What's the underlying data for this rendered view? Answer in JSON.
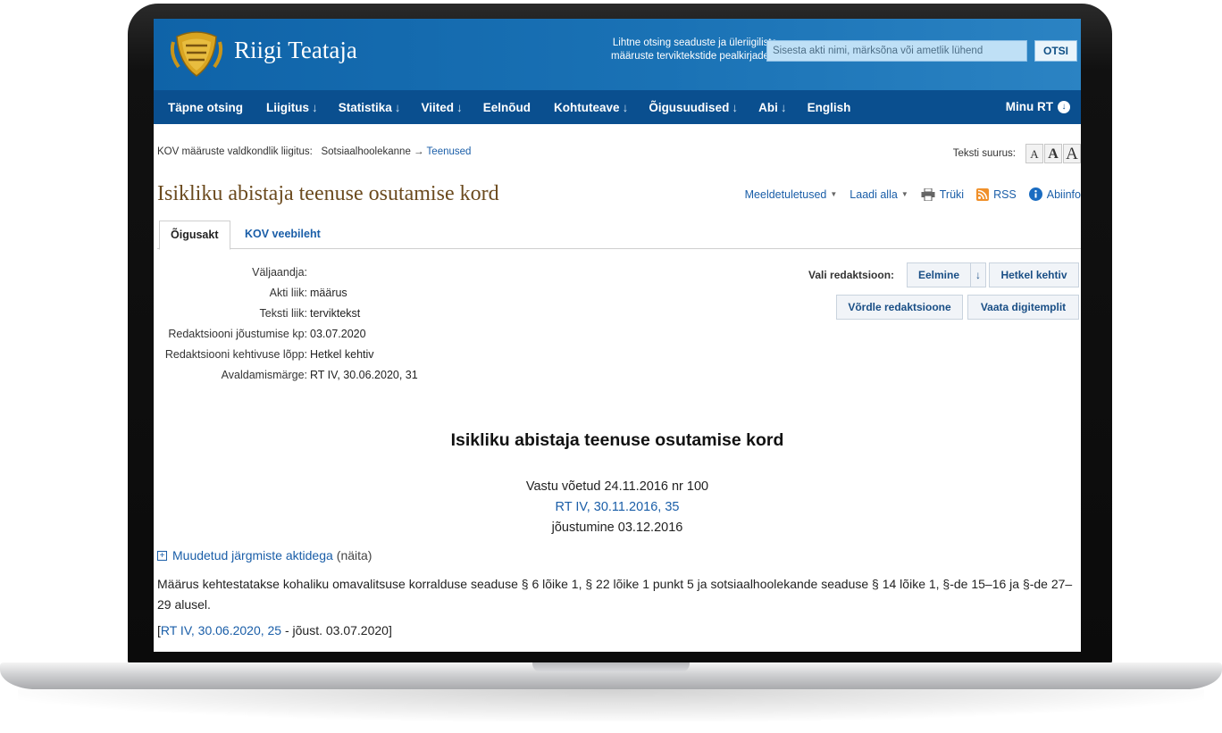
{
  "header": {
    "site_title": "Riigi Teataja",
    "search_hint_line1": "Lihtne otsing seaduste ja üleriigiliste",
    "search_hint_line2": "määruste terviktekstide pealkirjadest",
    "search_placeholder": "Sisesta akti nimi, märksõna või ametlik lühend",
    "search_button": "OTSI"
  },
  "nav": {
    "items": [
      {
        "label": "Täpne otsing",
        "arrow": ""
      },
      {
        "label": "Liigitus",
        "arrow": "↓"
      },
      {
        "label": "Statistika",
        "arrow": "↓"
      },
      {
        "label": "Viited",
        "arrow": "↓"
      },
      {
        "label": "Eelnõud",
        "arrow": ""
      },
      {
        "label": "Kohtuteave",
        "arrow": "↓"
      },
      {
        "label": "Õigusuudised",
        "arrow": "↓"
      },
      {
        "label": "Abi",
        "arrow": "↓"
      },
      {
        "label": "English",
        "arrow": ""
      }
    ],
    "my_rt": "Minu RT"
  },
  "breadcrumb": {
    "prefix": "KOV määruste valdkondlik liigitus:",
    "category": "Sotsiaalhoolekanne →",
    "link": "Teenused"
  },
  "text_size": {
    "label": "Teksti suurus:",
    "options": [
      "A",
      "A",
      "A"
    ]
  },
  "page": {
    "title": "Isikliku abistaja teenuse osutamise kord"
  },
  "tools": {
    "reminders": "Meeldetuletused",
    "download": "Laadi alla",
    "print": "Trüki",
    "rss": "RSS",
    "help": "Abiinfo"
  },
  "tabs": [
    {
      "label": "Õigusakt"
    },
    {
      "label": "KOV veebileht"
    }
  ],
  "meta": [
    {
      "label": "Väljaandja:",
      "value": ""
    },
    {
      "label": "Akti liik:",
      "value": "määrus"
    },
    {
      "label": "Teksti liik:",
      "value": "terviktekst"
    },
    {
      "label": "Redaktsiooni jõustumise kp:",
      "value": "03.07.2020"
    },
    {
      "label": "Redaktsiooni kehtivuse lõpp:",
      "value": "Hetkel kehtiv"
    },
    {
      "label": "Avaldamismärge:",
      "value": "RT IV, 30.06.2020, 31"
    }
  ],
  "redaction": {
    "label": "Vali redaktsioon:",
    "previous": "Eelmine",
    "arrow": "↓",
    "current": "Hetkel kehtiv",
    "compare": "Võrdle redaktsioone",
    "digital": "Vaata digitemplit"
  },
  "document": {
    "title": "Isikliku abistaja teenuse osutamise kord",
    "adopted": "Vastu võetud 24.11.2016 nr 100",
    "publication_link": "RT IV, 30.11.2016, 35",
    "entry_into_force": "jõustumine 03.12.2016",
    "amended_link": "Muudetud järgmiste aktidega",
    "amended_show": "(näita)",
    "body": "Määrus kehtestatakse kohaliku omavalitsuse korralduse seaduse § 6 lõike 1, § 22 lõike 1 punkt 5 ja sotsiaalhoolekande seaduse § 14 lõike 1, §-de 15–16 ja §-de 27–29 alusel.",
    "ref_open": "[",
    "ref_link": "RT IV, 30.06.2020, 25",
    "ref_rest": " - jõust. 03.07.2020]"
  }
}
